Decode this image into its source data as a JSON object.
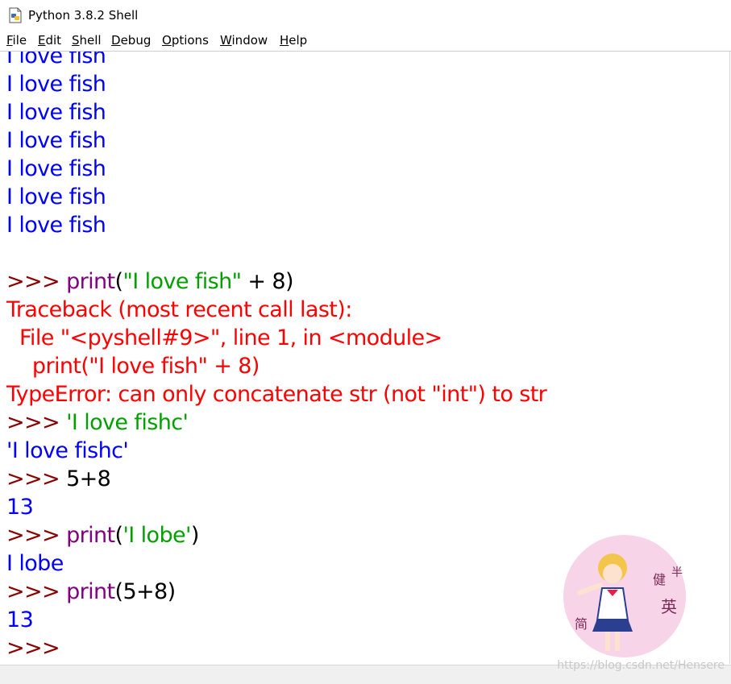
{
  "window": {
    "title": "Python 3.8.2 Shell"
  },
  "menu": [
    "File",
    "Edit",
    "Shell",
    "Debug",
    "Options",
    "Window",
    "Help"
  ],
  "output_lines": [
    "I love fish",
    "I love fish",
    "I love fish",
    "I love fish",
    "I love fish",
    "I love fish",
    "I love fish"
  ],
  "session": {
    "prompt": ">>> ",
    "cmd1": {
      "kw": "print",
      "open": "(",
      "str": "\"I love fish\"",
      "rest": " + 8)"
    },
    "traceback": [
      "Traceback (most recent call last):",
      "  File \"<pyshell#9>\", line 1, in <module>",
      "    print(\"I love fish\" + 8)",
      "TypeError: can only concatenate str (not \"int\") to str"
    ],
    "cmd2": {
      "str": "'I love fishc'"
    },
    "out2": "'I love fishc'",
    "cmd3": {
      "plain": "5+8"
    },
    "out3": "13",
    "cmd4": {
      "kw": "print",
      "open": "(",
      "str": "'I lobe'",
      "close": ")"
    },
    "out4": "I lobe",
    "cmd5": {
      "kw": "print",
      "rest": "(5+8)"
    },
    "out5": "13"
  },
  "watermark": "https://blog.csdn.net/Hensere",
  "sticker_chars": [
    "健",
    "半",
    "英",
    "简"
  ],
  "colors": {
    "prompt": "#8b0000",
    "keyword": "#800080",
    "string": "#00a000",
    "output": "#0000ff",
    "error": "#ff0000"
  }
}
